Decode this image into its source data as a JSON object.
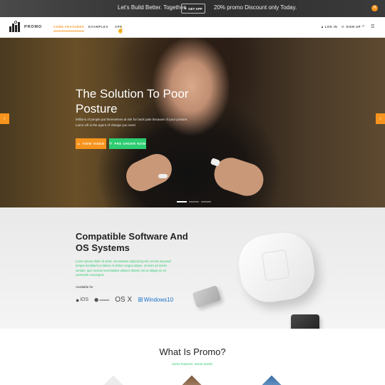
{
  "topbar": {
    "tagline": "Let's Build Better. Together.",
    "get_app": "GET APP",
    "promo": "20% promo Discount only Today."
  },
  "header": {
    "brand": "PROMO",
    "nav": [
      "CORE FEATURES",
      "EXAMPLES",
      "APP"
    ],
    "login": "LOG IN",
    "signup": "SIGN UP"
  },
  "hero": {
    "title": "The Solution To Poor Posture",
    "body": "Millions of people put themselves at risk for back pain because of poor posture. Lumo Lift is the agent of change you need",
    "btn_video": "VIEW VIDEO",
    "btn_preorder": "PRE ORDER NOW"
  },
  "software": {
    "title": "Compatible Software And OS Systems",
    "lorem": "Lorem ipsum dolor sit amet, consectetur adipisicing elit, sed do eiusmod tempor incididunt ut labore et dolore magna aliqua. Ut enim ad minim veniam, quis nostrud exercitation ullamco laboris nisi ut aliquip ex ea commodo consequat.",
    "available": "Available for",
    "os": {
      "ios": "iOS",
      "android": "ANDROID",
      "osx": "OS X",
      "windows": "Windows10"
    }
  },
  "whatis": {
    "title": "What Is Promo?",
    "subtitle": "Some features. Some words."
  },
  "colors": {
    "accent": "#f7941d",
    "green": "#2ecc71"
  }
}
